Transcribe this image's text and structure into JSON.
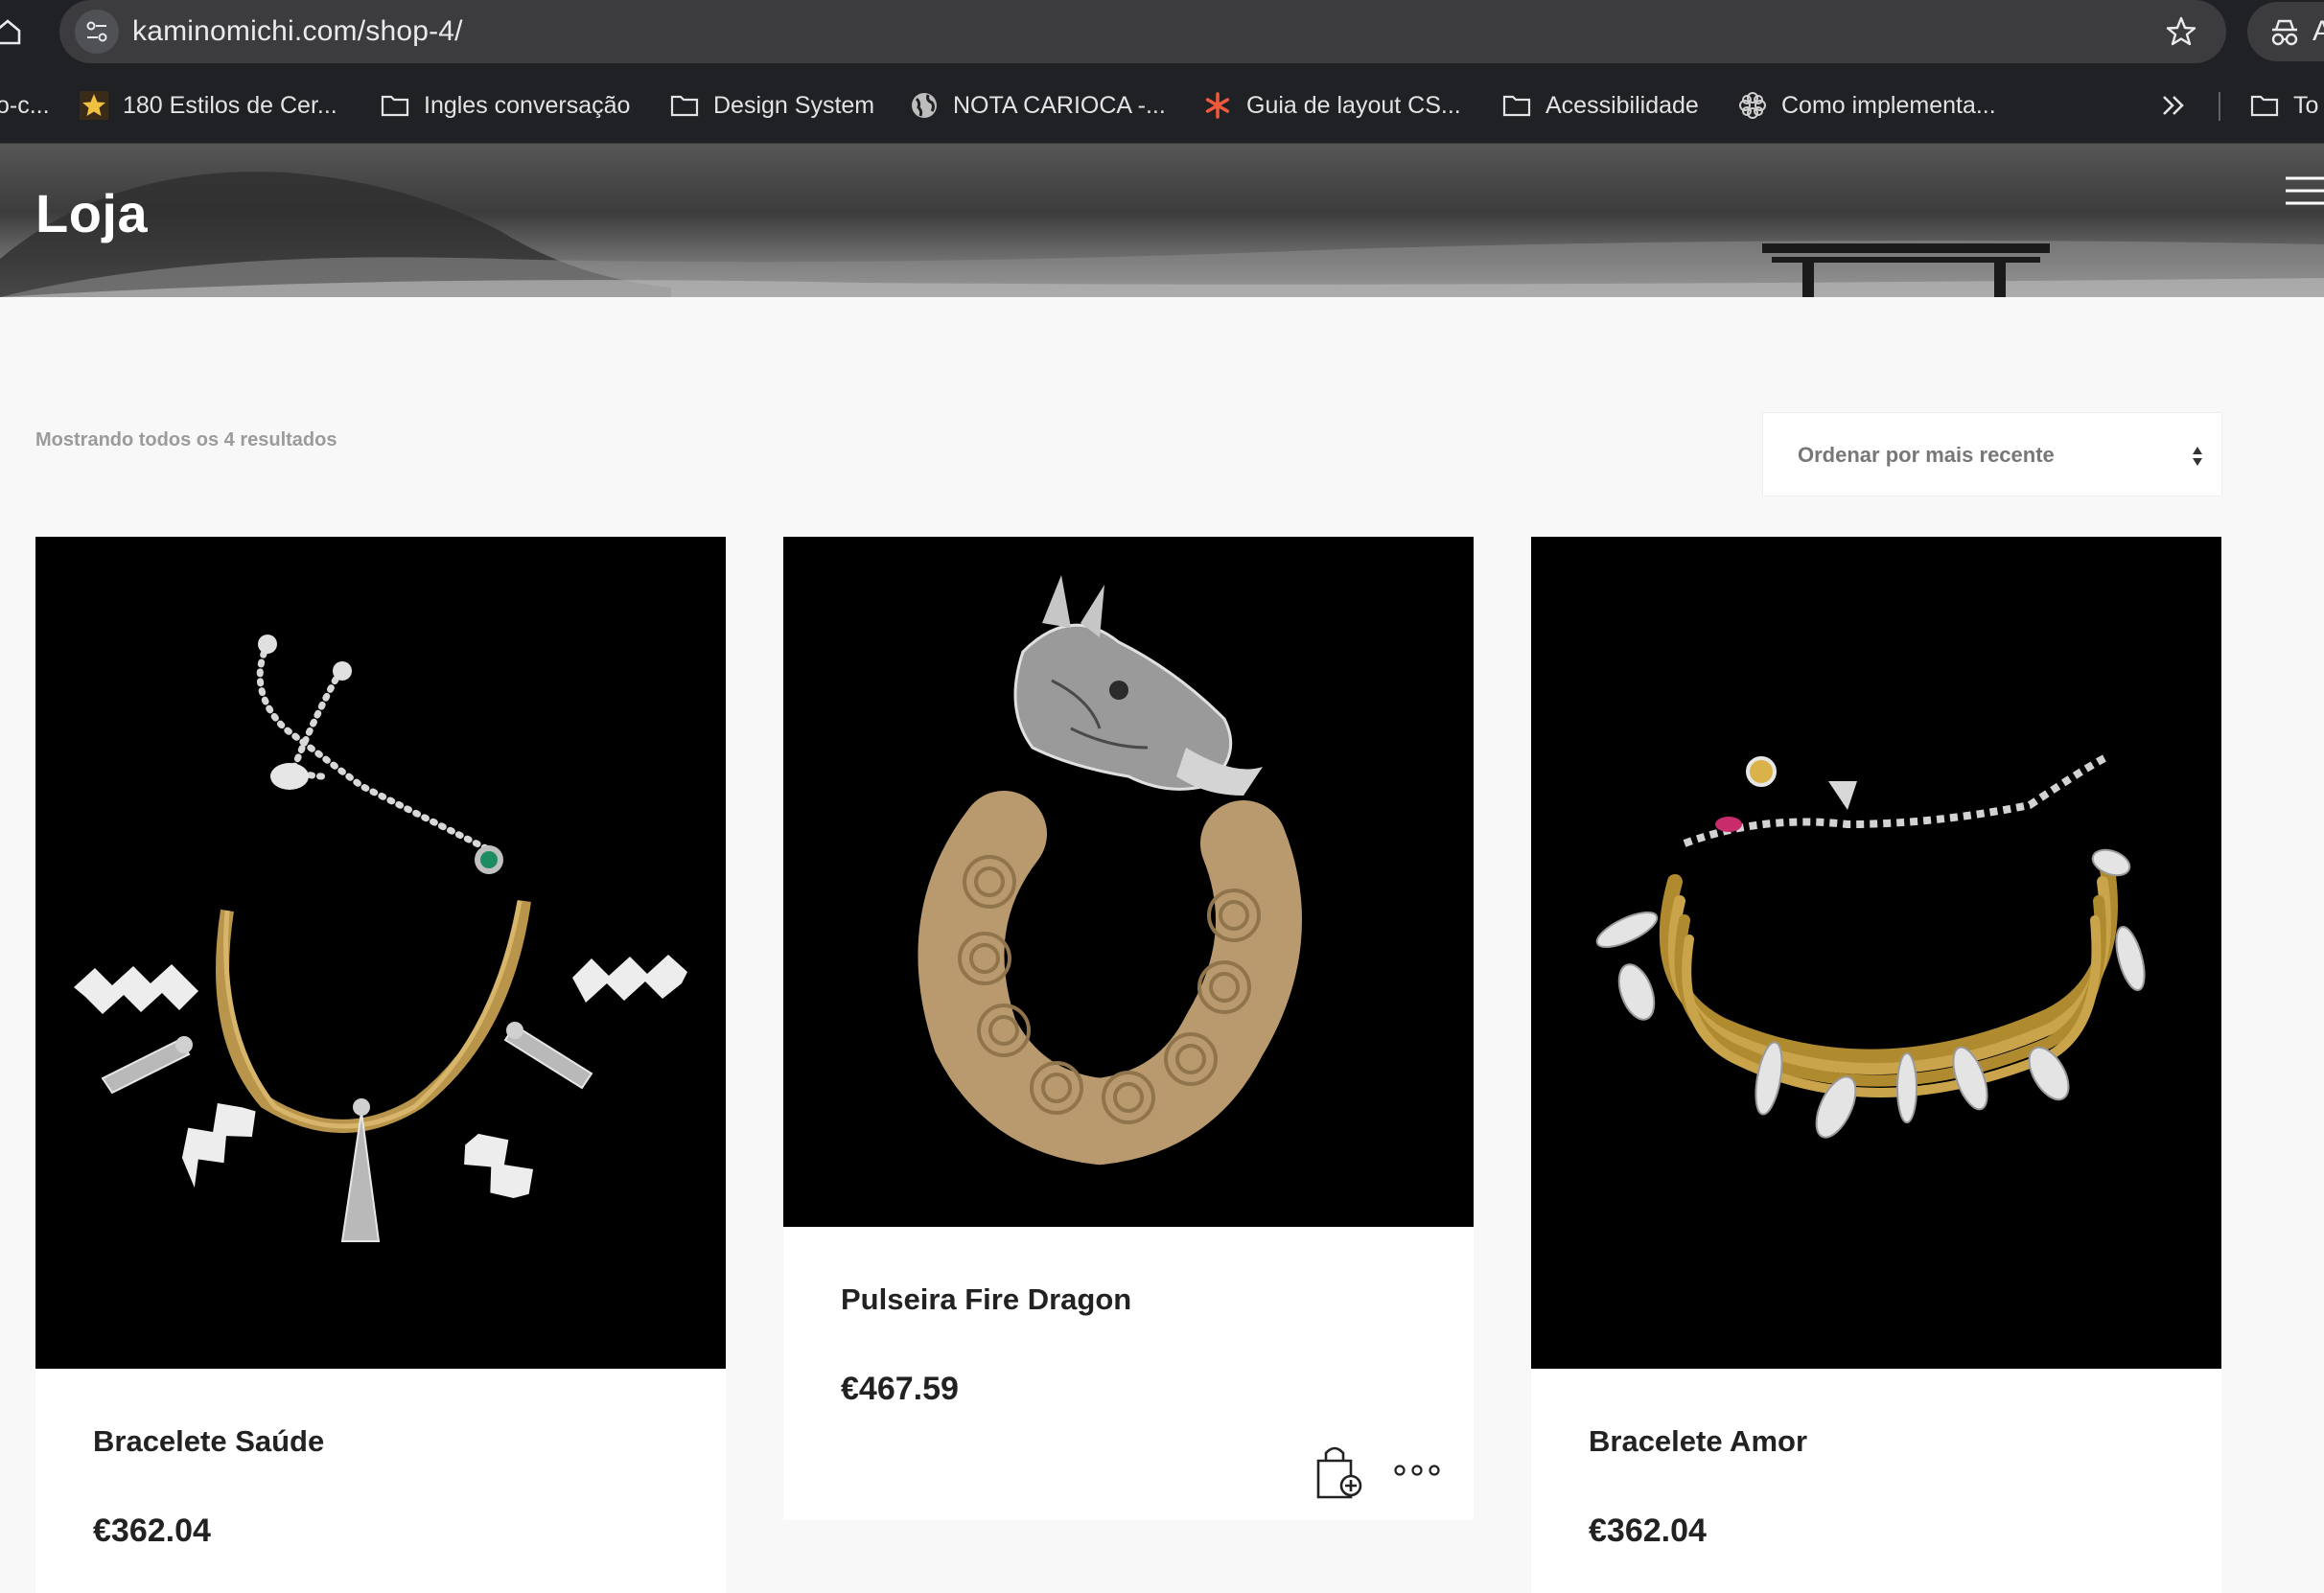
{
  "browser": {
    "url": "kaminomichi.com/shop-4/",
    "profile_initial": "A",
    "bookmarks": [
      {
        "label": "o-c...",
        "icon": "none"
      },
      {
        "label": "180 Estilos de Cer...",
        "icon": "star-favicon"
      },
      {
        "label": "Ingles conversação",
        "icon": "folder-icon"
      },
      {
        "label": "Design System",
        "icon": "folder-icon"
      },
      {
        "label": "NOTA CARIOCA -...",
        "icon": "globe-icon"
      },
      {
        "label": "Guia de layout CS...",
        "icon": "asterisk-favicon"
      },
      {
        "label": "Acessibilidade",
        "icon": "folder-icon"
      },
      {
        "label": "Como implementa...",
        "icon": "flower-favicon"
      },
      {
        "label": "To",
        "icon": "folder-icon"
      }
    ]
  },
  "hero": {
    "title": "Loja"
  },
  "shop": {
    "result_count": "Mostrando todos os 4 resultados",
    "sort": {
      "selected": "Ordenar por mais recente"
    }
  },
  "products": [
    {
      "name": "Bracelete Saúde",
      "price": "€362.04",
      "image": "silver chain bracelet with zigzag and tassel charms"
    },
    {
      "name": "Pulseira Fire Dragon",
      "price": "€467.59",
      "image": "woven golden grass bracelet with silver dragon head"
    },
    {
      "name": "Bracelete Amor",
      "price": "€362.04",
      "image": "golden grass cuff with silver leaf charms"
    }
  ],
  "colors": {
    "chrome_bg": "#202124",
    "omnibox_bg": "#3c3c3f",
    "page_bg": "#f8f8f8",
    "text_dark": "#222222",
    "text_muted": "#9b9b9b"
  }
}
